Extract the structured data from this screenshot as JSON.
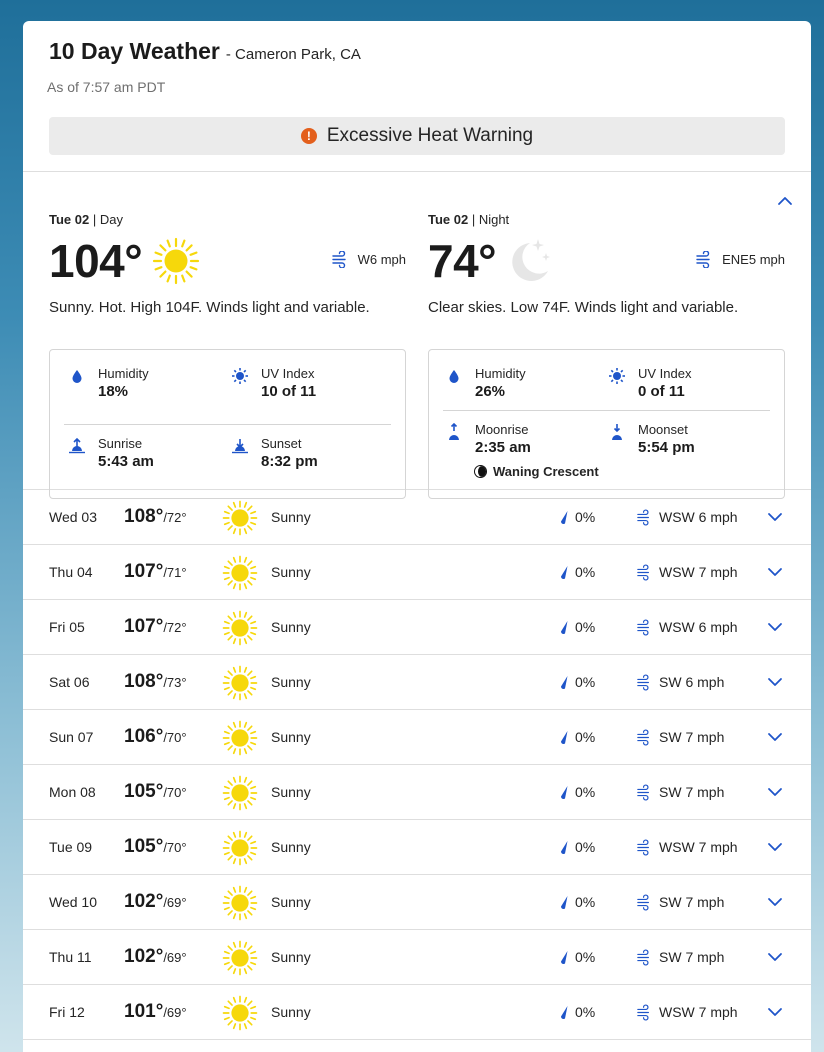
{
  "header": {
    "title": "10 Day Weather",
    "location": "- Cameron Park, CA",
    "as_of": "As of 7:57 am PDT",
    "alert": "Excessive Heat Warning"
  },
  "today": {
    "day": {
      "date": "Tue 02",
      "period": " | Day",
      "temp": "104°",
      "icon": "sun-icon",
      "wind": "W6 mph",
      "narrative": "Sunny. Hot. High 104F. Winds light and variable.",
      "humidity_label": "Humidity",
      "humidity": "18%",
      "uv_label": "UV Index",
      "uv": "10 of 11",
      "sunrise_label": "Sunrise",
      "sunrise": "5:43 am",
      "sunset_label": "Sunset",
      "sunset": "8:32 pm"
    },
    "night": {
      "date": "Tue 02",
      "period": " | Night",
      "temp": "74°",
      "icon": "moon-stars-icon",
      "wind": "ENE5 mph",
      "narrative": "Clear skies. Low 74F. Winds light and variable.",
      "humidity_label": "Humidity",
      "humidity": "26%",
      "uv_label": "UV Index",
      "uv": "0 of 11",
      "moonrise_label": "Moonrise",
      "moonrise": "2:35 am",
      "moonset_label": "Moonset",
      "moonset": "5:54 pm",
      "moon_phase": "Waning Crescent"
    }
  },
  "days": [
    {
      "day": "Wed 03",
      "hi": "108°",
      "lo": "/72°",
      "cond": "Sunny",
      "precip": "0%",
      "wind": "WSW 6 mph"
    },
    {
      "day": "Thu 04",
      "hi": "107°",
      "lo": "/71°",
      "cond": "Sunny",
      "precip": "0%",
      "wind": "WSW 7 mph"
    },
    {
      "day": "Fri 05",
      "hi": "107°",
      "lo": "/72°",
      "cond": "Sunny",
      "precip": "0%",
      "wind": "WSW 6 mph"
    },
    {
      "day": "Sat 06",
      "hi": "108°",
      "lo": "/73°",
      "cond": "Sunny",
      "precip": "0%",
      "wind": "SW 6 mph"
    },
    {
      "day": "Sun 07",
      "hi": "106°",
      "lo": "/70°",
      "cond": "Sunny",
      "precip": "0%",
      "wind": "SW 7 mph"
    },
    {
      "day": "Mon 08",
      "hi": "105°",
      "lo": "/70°",
      "cond": "Sunny",
      "precip": "0%",
      "wind": "SW 7 mph"
    },
    {
      "day": "Tue 09",
      "hi": "105°",
      "lo": "/70°",
      "cond": "Sunny",
      "precip": "0%",
      "wind": "WSW 7 mph"
    },
    {
      "day": "Wed 10",
      "hi": "102°",
      "lo": "/69°",
      "cond": "Sunny",
      "precip": "0%",
      "wind": "SW 7 mph"
    },
    {
      "day": "Thu 11",
      "hi": "102°",
      "lo": "/69°",
      "cond": "Sunny",
      "precip": "0%",
      "wind": "SW 7 mph"
    },
    {
      "day": "Fri 12",
      "hi": "101°",
      "lo": "/69°",
      "cond": "Sunny",
      "precip": "0%",
      "wind": "WSW 7 mph"
    }
  ],
  "colors": {
    "accent": "#1f55c9",
    "sun": "#f6d80b",
    "alert": "#e35f1c"
  }
}
